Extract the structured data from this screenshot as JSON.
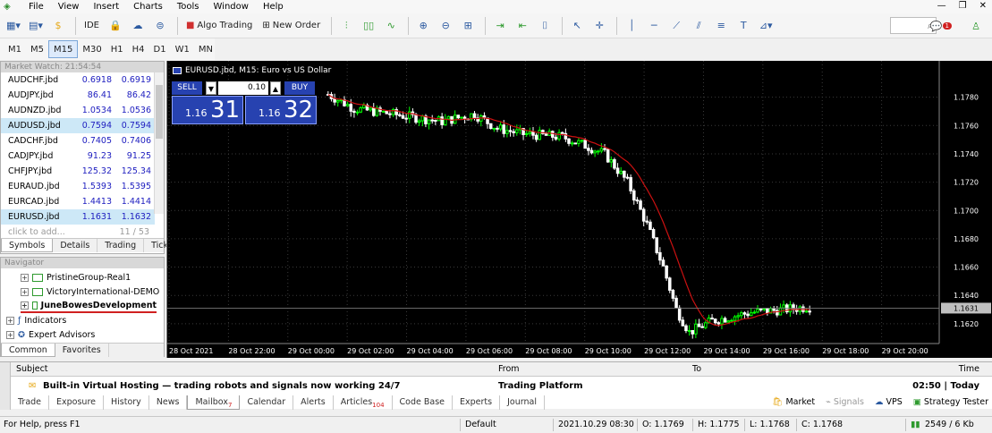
{
  "menu": [
    "File",
    "View",
    "Insert",
    "Charts",
    "Tools",
    "Window",
    "Help"
  ],
  "toolbar": {
    "ide_label": "IDE",
    "algo_trading_label": "Algo Trading",
    "new_order_label": "New Order",
    "notification_count": "1"
  },
  "timeframes": [
    "M1",
    "M5",
    "M15",
    "M30",
    "H1",
    "H4",
    "D1",
    "W1",
    "MN"
  ],
  "active_timeframe": "M15",
  "market_watch": {
    "title": "Market Watch: 21:54:54",
    "rows": [
      {
        "symbol": "AUDCHF.jbd",
        "bid": "0.6918",
        "ask": "0.6919"
      },
      {
        "symbol": "AUDJPY.jbd",
        "bid": "86.41",
        "ask": "86.42"
      },
      {
        "symbol": "AUDNZD.jbd",
        "bid": "1.0534",
        "ask": "1.0536"
      },
      {
        "symbol": "AUDUSD.jbd",
        "bid": "0.7594",
        "ask": "0.7594"
      },
      {
        "symbol": "CADCHF.jbd",
        "bid": "0.7405",
        "ask": "0.7406"
      },
      {
        "symbol": "CADJPY.jbd",
        "bid": "91.23",
        "ask": "91.25"
      },
      {
        "symbol": "CHFJPY.jbd",
        "bid": "125.32",
        "ask": "125.34"
      },
      {
        "symbol": "EURAUD.jbd",
        "bid": "1.5393",
        "ask": "1.5395"
      },
      {
        "symbol": "EURCAD.jbd",
        "bid": "1.4413",
        "ask": "1.4414"
      },
      {
        "symbol": "EURUSD.jbd",
        "bid": "1.1631",
        "ask": "1.1632"
      }
    ],
    "add_hint": "click to add...",
    "count": "11 / 53",
    "tabs": [
      "Symbols",
      "Details",
      "Trading",
      "Ticks"
    ]
  },
  "navigator": {
    "title": "Navigator",
    "items": [
      "PristineGroup-Real1",
      "VictoryInternational-DEMO",
      "JuneBowesDevelopment",
      "Indicators",
      "Expert Advisors"
    ],
    "tabs": [
      "Common",
      "Favorites"
    ]
  },
  "chart": {
    "title": "EURUSD.jbd, M15:  Euro vs US Dollar",
    "sell_label": "SELL",
    "buy_label": "BUY",
    "lot": "0.10",
    "sell_small": "1.16",
    "sell_big": "31",
    "buy_small": "1.16",
    "buy_big": "32",
    "current_price_label": "1.1631"
  },
  "chart_data": {
    "type": "candlestick",
    "y_ticks": [
      "1.1780",
      "1.1760",
      "1.1740",
      "1.1720",
      "1.1700",
      "1.1680",
      "1.1660",
      "1.1640",
      "1.1620"
    ],
    "ylim": [
      1.1606,
      1.1788
    ],
    "x_ticks": [
      "28 Oct 2021",
      "28 Oct 22:00",
      "29 Oct 00:00",
      "29 Oct 02:00",
      "29 Oct 04:00",
      "29 Oct 06:00",
      "29 Oct 08:00",
      "29 Oct 10:00",
      "29 Oct 12:00",
      "29 Oct 14:00",
      "29 Oct 16:00",
      "29 Oct 18:00",
      "29 Oct 20:00"
    ],
    "current_price": 1.1631,
    "colors": {
      "up": "#00ff00",
      "down": "#ffffff",
      "ma": "#cc1111",
      "background": "#000000",
      "grid": "#3a3a3a"
    }
  },
  "toolbox": {
    "headers": {
      "subject": "Subject",
      "from": "From",
      "to": "To",
      "time": "Time"
    },
    "row": {
      "subject": "Built-in Virtual Hosting — trading robots and signals now working 24/7",
      "from": "Trading Platform",
      "to": "",
      "time": "02:50 | Today"
    },
    "tabs": [
      "Trade",
      "Exposure",
      "History",
      "News",
      "Mailbox",
      "Calendar",
      "Alerts",
      "Articles",
      "Code Base",
      "Experts",
      "Journal"
    ],
    "mailbox_badge": "7",
    "articles_badge": "104",
    "active_tab": "Mailbox",
    "right_items": [
      "Market",
      "Signals",
      "VPS",
      "Strategy Tester"
    ]
  },
  "status": {
    "help": "For Help, press F1",
    "profile": "Default",
    "datetime": "2021.10.29 08:30",
    "open": "O: 1.1769",
    "high": "H: 1.1775",
    "low": "L: 1.1768",
    "close": "C: 1.1768",
    "traffic": "2549 / 6 Kb"
  }
}
